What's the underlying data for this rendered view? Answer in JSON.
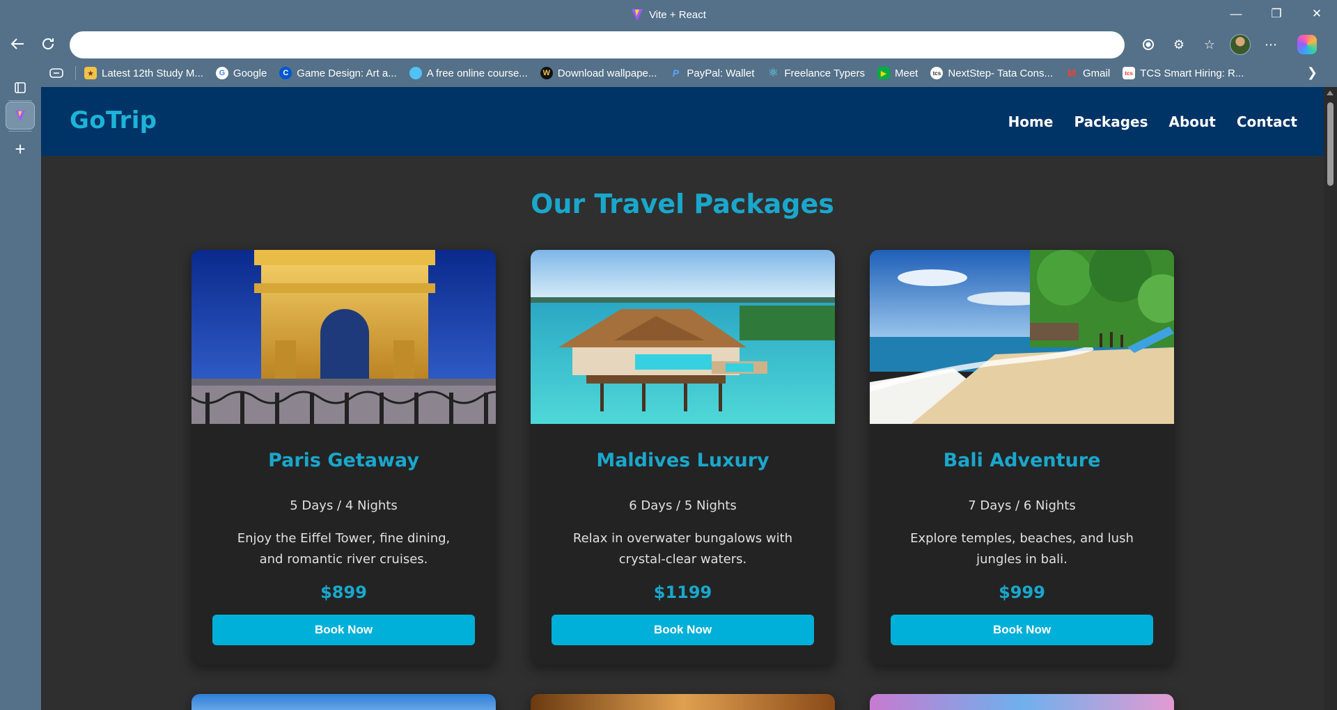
{
  "browser": {
    "window_title": "Vite + React",
    "address_value": "",
    "bookmarks": [
      {
        "label": "Latest 12th Study M...",
        "icon": "study-favicon",
        "color": "#f4c24a"
      },
      {
        "label": "Google",
        "icon": "google-favicon",
        "color": "#ffffff"
      },
      {
        "label": "Game Design: Art a...",
        "icon": "coursera-favicon",
        "color": "#0056d2"
      },
      {
        "label": "A free online course...",
        "icon": "course-favicon",
        "color": "#4fc3f7"
      },
      {
        "label": "Download wallpape...",
        "icon": "wallpaper-favicon",
        "color": "#111111"
      },
      {
        "label": "PayPal: Wallet",
        "icon": "paypal-favicon",
        "color": "#003087"
      },
      {
        "label": "Freelance Typers",
        "icon": "react-favicon",
        "color": "#61dafb"
      },
      {
        "label": "Meet",
        "icon": "meet-favicon",
        "color": "#00ac47"
      },
      {
        "label": "NextStep- Tata Cons...",
        "icon": "tcs-favicon",
        "color": "#ffffff"
      },
      {
        "label": "Gmail",
        "icon": "gmail-favicon",
        "color": "#ea4335"
      },
      {
        "label": "TCS Smart Hiring: R...",
        "icon": "tcs-hiring-favicon",
        "color": "#e53935"
      }
    ]
  },
  "site": {
    "logo": "GoTrip",
    "nav": [
      "Home",
      "Packages",
      "About",
      "Contact"
    ],
    "section_title": "Our Travel Packages",
    "colors": {
      "header": "#003366",
      "accent": "#1aa7cc",
      "button": "#00b0d8",
      "card": "#232323",
      "background": "#2f2f2f"
    },
    "packages": [
      {
        "title": "Paris Getaway",
        "duration": "5 Days / 4 Nights",
        "description": "Enjoy the Eiffel Tower, fine dining, and romantic river cruises.",
        "price": "$899",
        "button": "Book Now",
        "image": "arc-de-triomphe-night"
      },
      {
        "title": "Maldives Luxury",
        "duration": "6 Days / 5 Nights",
        "description": "Relax in overwater bungalows with crystal-clear waters.",
        "price": "$1199",
        "button": "Book Now",
        "image": "overwater-bungalow"
      },
      {
        "title": "Bali Adventure",
        "duration": "7 Days / 6 Nights",
        "description": "Explore temples, beaches, and lush jungles in bali.",
        "price": "$999",
        "button": "Book Now",
        "image": "tropical-beach"
      }
    ]
  }
}
